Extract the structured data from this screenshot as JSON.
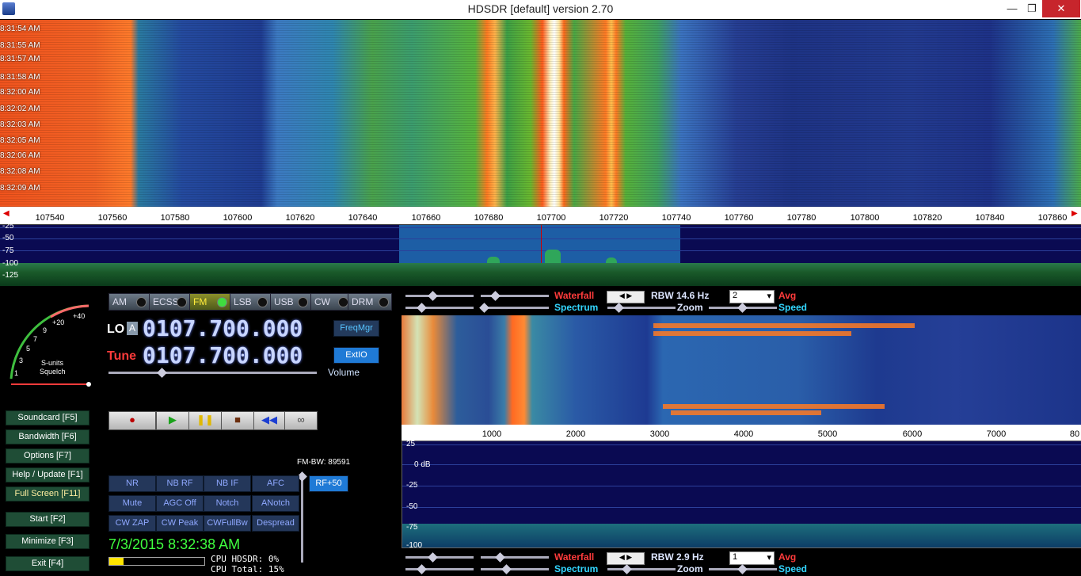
{
  "window": {
    "title": "HDSDR [default]  version 2.70",
    "minimize": "—",
    "restore": "❐",
    "close": "✕"
  },
  "waterfall_times": [
    "8:31:54 AM",
    "8:31:55 AM",
    "8:31:57 AM",
    "8:31:58 AM",
    "8:32:00 AM",
    "8:32:02 AM",
    "8:32:03 AM",
    "8:32:05 AM",
    "8:32:06 AM",
    "8:32:08 AM",
    "8:32:09 AM"
  ],
  "freq_scale": [
    "107540",
    "107560",
    "107580",
    "107600",
    "107620",
    "107640",
    "107660",
    "107680",
    "107700",
    "107720",
    "107740",
    "107760",
    "107780",
    "107800",
    "107820",
    "107840",
    "107860"
  ],
  "spectrum_db": [
    "-25",
    "-50",
    "-75",
    "-100",
    "-125"
  ],
  "smeter": {
    "labels": [
      "+40",
      "+20",
      "9",
      "7",
      "5",
      "3",
      "1"
    ],
    "title": "S-units",
    "subtitle": "Squelch"
  },
  "left_buttons": [
    {
      "label": "Soundcard  [F5]"
    },
    {
      "label": "Bandwidth  [F6]"
    },
    {
      "label": "Options   [F7]"
    },
    {
      "label": "Help / Update  [F1]"
    },
    {
      "label": "Full Screen  [F11]"
    },
    {
      "label": "Start      [F2]"
    },
    {
      "label": "Minimize  [F3]"
    },
    {
      "label": "Exit       [F4]"
    }
  ],
  "modes": [
    {
      "label": "AM"
    },
    {
      "label": "ECSS"
    },
    {
      "label": "FM"
    },
    {
      "label": "LSB"
    },
    {
      "label": "USB"
    },
    {
      "label": "CW"
    },
    {
      "label": "DRM"
    }
  ],
  "active_mode": "FM",
  "lo": {
    "label": "LO",
    "a_button": "A",
    "value": "0107.700.000"
  },
  "tune": {
    "label": "Tune",
    "value": "0107.700.000"
  },
  "volume_label": "Volume",
  "freqmgr": "FreqMgr",
  "extio": "ExtIO",
  "transport": [
    "●",
    "▶",
    "❚❚",
    "■",
    "◀◀",
    "∞"
  ],
  "fm_bw": "FM-BW: 89591",
  "rf_button": "RF+50",
  "dsp_buttons": [
    [
      "NR",
      "NB RF",
      "NB IF",
      "AFC"
    ],
    [
      "Mute",
      "AGC Off",
      "Notch",
      "ANotch"
    ],
    [
      "CW ZAP",
      "CW Peak",
      "CWFullBw",
      "Despread"
    ]
  ],
  "datetime": "7/3/2015 8:32:38 AM",
  "cpu": {
    "hdsdr": "CPU HDSDR: 0%",
    "total": "CPU Total: 15%"
  },
  "top_controls": {
    "waterfall": "Waterfall",
    "rbw": "RBW 14.6 Hz",
    "avg_value": "2",
    "avg": "Avg",
    "spectrum": "Spectrum",
    "zoom": "Zoom",
    "speed": "Speed"
  },
  "audio_scale": [
    "1000",
    "2000",
    "3000",
    "4000",
    "5000",
    "6000",
    "7000",
    "80"
  ],
  "audio_db": [
    "25",
    "0 dB",
    "-25",
    "-50",
    "-75",
    "-100"
  ],
  "bottom_controls": {
    "waterfall": "Waterfall",
    "rbw": "RBW  2.9 Hz",
    "avg_value": "1",
    "avg": "Avg",
    "spectrum": "Spectrum",
    "zoom": "Zoom",
    "speed": "Speed"
  },
  "colors": {
    "accent_red": "#ff3b3b",
    "accent_cyan": "#33d6ff",
    "freq_digits": "#c9d6ff",
    "clock_green": "#3fff3f"
  }
}
